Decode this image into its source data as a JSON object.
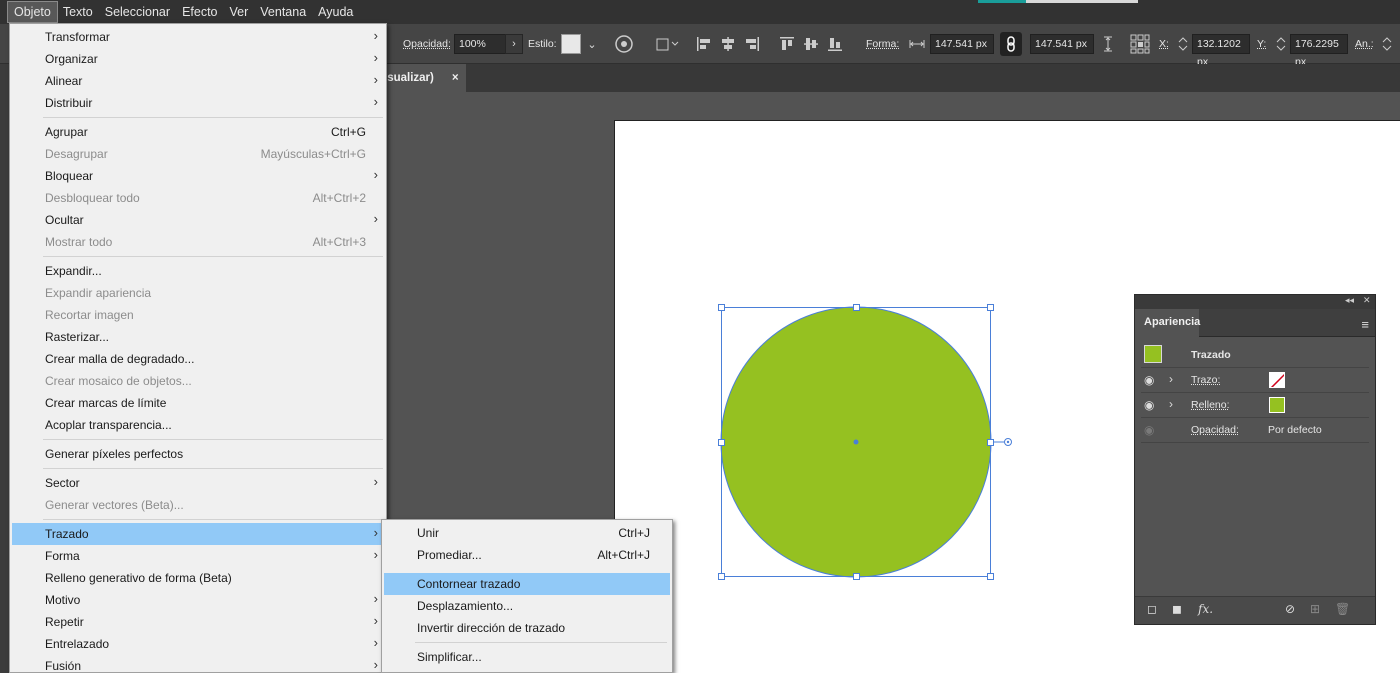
{
  "menubar": {
    "items": [
      "Objeto",
      "Texto",
      "Seleccionar",
      "Efecto",
      "Ver",
      "Ventana",
      "Ayuda"
    ],
    "active": "Objeto"
  },
  "controlbar": {
    "opacity_label": "Opacidad:",
    "opacity_value": "100%",
    "style_label": "Estilo:",
    "shape_label": "Forma:",
    "width_value": "147.541 px",
    "height_value": "147.541 px",
    "x_label": "X:",
    "x_value": "132.1202 px",
    "y_label": "Y:",
    "y_value": "176.2295 px",
    "an_label": "An.:"
  },
  "doc_tab": {
    "title": "isualizar)",
    "close": "×"
  },
  "objeto_menu": {
    "items": [
      {
        "label": "Transformar",
        "shortcut": "",
        "submenu": true,
        "disabled": false
      },
      {
        "label": "Organizar",
        "shortcut": "",
        "submenu": true,
        "disabled": false
      },
      {
        "label": "Alinear",
        "shortcut": "",
        "submenu": true,
        "disabled": false
      },
      {
        "label": "Distribuir",
        "shortcut": "",
        "submenu": true,
        "disabled": false
      },
      {
        "label": "Agrupar",
        "shortcut": "Ctrl+G",
        "submenu": false,
        "disabled": false
      },
      {
        "label": "Desagrupar",
        "shortcut": "Mayúsculas+Ctrl+G",
        "submenu": false,
        "disabled": true
      },
      {
        "label": "Bloquear",
        "shortcut": "",
        "submenu": true,
        "disabled": false
      },
      {
        "label": "Desbloquear todo",
        "shortcut": "Alt+Ctrl+2",
        "submenu": false,
        "disabled": true
      },
      {
        "label": "Ocultar",
        "shortcut": "",
        "submenu": true,
        "disabled": false
      },
      {
        "label": "Mostrar todo",
        "shortcut": "Alt+Ctrl+3",
        "submenu": false,
        "disabled": true
      },
      {
        "label": "Expandir...",
        "shortcut": "",
        "submenu": false,
        "disabled": false
      },
      {
        "label": "Expandir apariencia",
        "shortcut": "",
        "submenu": false,
        "disabled": true
      },
      {
        "label": "Recortar imagen",
        "shortcut": "",
        "submenu": false,
        "disabled": true
      },
      {
        "label": "Rasterizar...",
        "shortcut": "",
        "submenu": false,
        "disabled": false
      },
      {
        "label": "Crear malla de degradado...",
        "shortcut": "",
        "submenu": false,
        "disabled": false
      },
      {
        "label": "Crear mosaico de objetos...",
        "shortcut": "",
        "submenu": false,
        "disabled": true
      },
      {
        "label": "Crear marcas de límite",
        "shortcut": "",
        "submenu": false,
        "disabled": false
      },
      {
        "label": "Acoplar transparencia...",
        "shortcut": "",
        "submenu": false,
        "disabled": false
      },
      {
        "label": "Generar píxeles perfectos",
        "shortcut": "",
        "submenu": false,
        "disabled": false
      },
      {
        "label": "Sector",
        "shortcut": "",
        "submenu": true,
        "disabled": false
      },
      {
        "label": "Generar vectores (Beta)...",
        "shortcut": "",
        "submenu": false,
        "disabled": true
      },
      {
        "label": "Trazado",
        "shortcut": "",
        "submenu": true,
        "disabled": false
      },
      {
        "label": "Forma",
        "shortcut": "",
        "submenu": true,
        "disabled": false
      },
      {
        "label": "Relleno generativo de forma (Beta)",
        "shortcut": "",
        "submenu": false,
        "disabled": false
      },
      {
        "label": "Motivo",
        "shortcut": "",
        "submenu": true,
        "disabled": false
      },
      {
        "label": "Repetir",
        "shortcut": "",
        "submenu": true,
        "disabled": false
      },
      {
        "label": "Entrelazado",
        "shortcut": "",
        "submenu": true,
        "disabled": false
      },
      {
        "label": "Fusión",
        "shortcut": "",
        "submenu": true,
        "disabled": false
      }
    ]
  },
  "trazado_submenu": {
    "items": [
      {
        "label": "Unir",
        "shortcut": "Ctrl+J"
      },
      {
        "label": "Promediar...",
        "shortcut": "Alt+Ctrl+J"
      },
      {
        "label": "Contornear trazado",
        "shortcut": ""
      },
      {
        "label": "Desplazamiento...",
        "shortcut": ""
      },
      {
        "label": "Invertir dirección de trazado",
        "shortcut": ""
      },
      {
        "label": "Simplificar...",
        "shortcut": ""
      }
    ]
  },
  "circle": {
    "fill": "#95c121",
    "stroke": "#4a7fd8",
    "selection_color": "#4a7fd8"
  },
  "apariencia": {
    "tab": "Apariencia",
    "object_type": "Trazado",
    "object_swatch": "#95c121",
    "stroke_label": "Trazo:",
    "fill_label": "Relleno:",
    "fill_swatch": "#95c121",
    "opacity_label": "Opacidad:",
    "opacity_value": "Por defecto"
  },
  "icons": [
    "eye-icon",
    "chevron-right-icon",
    "link-icon",
    "panel-menu-icon",
    "new-stroke-icon",
    "new-fill-icon",
    "fx-icon",
    "clear-icon",
    "duplicate-icon",
    "trash-icon"
  ]
}
